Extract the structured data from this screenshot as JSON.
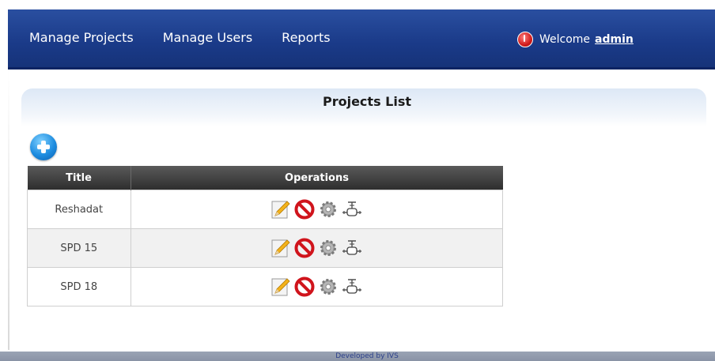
{
  "nav": {
    "items": [
      {
        "label": "Manage Projects"
      },
      {
        "label": "Manage Users"
      },
      {
        "label": "Reports"
      }
    ]
  },
  "user": {
    "welcome_label": "Welcome",
    "username": "admin"
  },
  "page": {
    "title": "Projects List"
  },
  "table": {
    "headers": [
      "Title",
      "Operations"
    ],
    "rows": [
      {
        "title": "Reshadat"
      },
      {
        "title": "SPD 15"
      },
      {
        "title": "SPD 18"
      }
    ],
    "operation_icons": [
      "edit-pencil-icon",
      "delete-no-icon",
      "settings-gear-icon",
      "valve-icon"
    ]
  },
  "footer": {
    "text": "Developed by IVS"
  },
  "colors": {
    "header_bar": "#1a3a88",
    "table_header": "#3a3a3a",
    "accent_blue": "#1e8de0",
    "delete_red": "#d0141c"
  }
}
